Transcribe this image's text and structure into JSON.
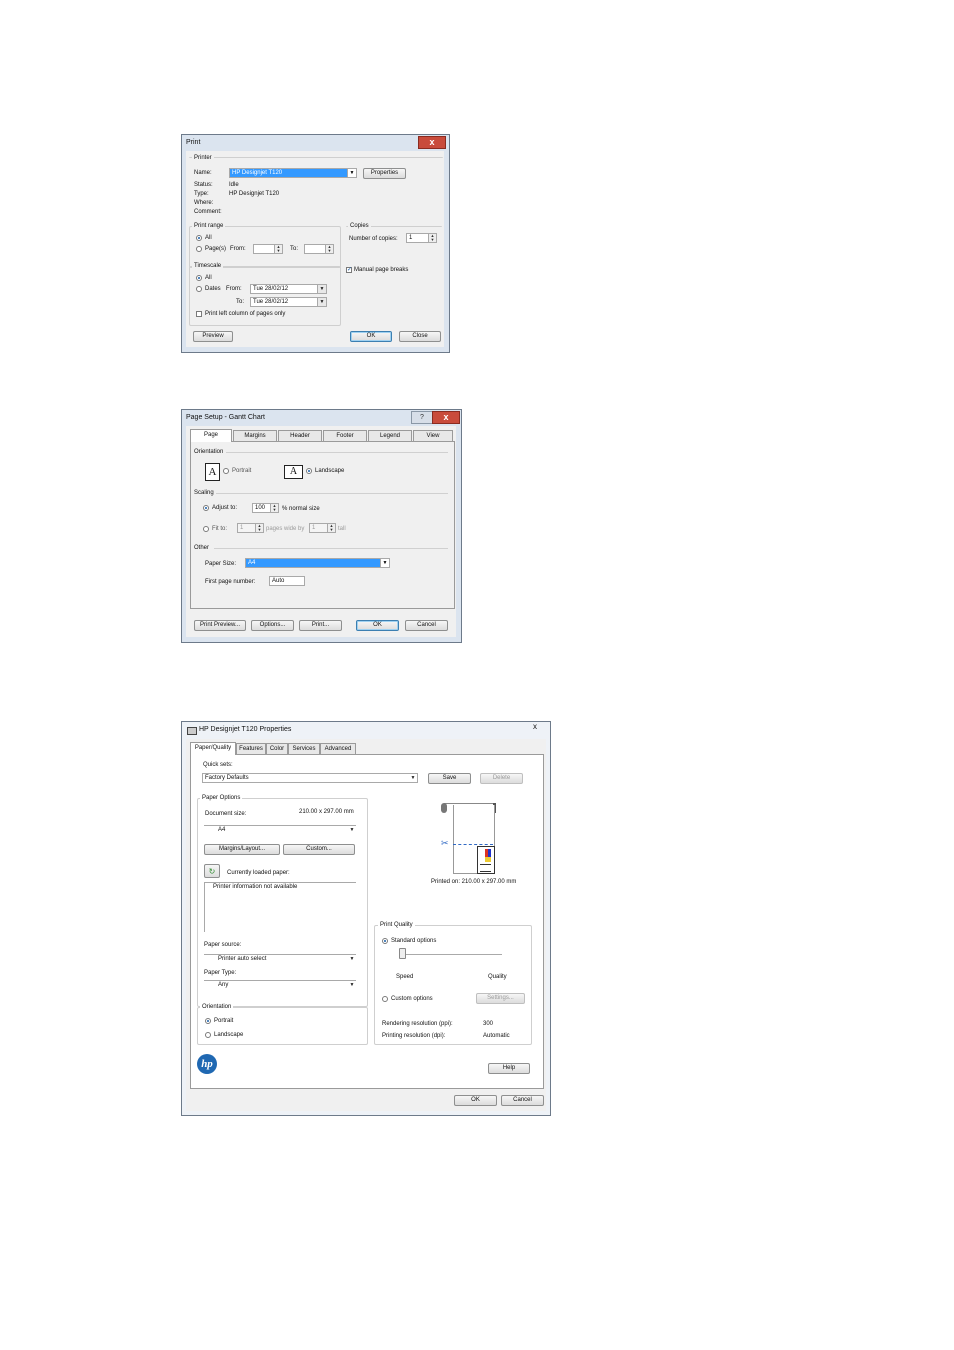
{
  "print_dialog": {
    "title": "Print",
    "close_glyph": "x",
    "printer": {
      "group": "Printer",
      "name_label": "Name:",
      "name_value": "HP Designjet T120",
      "properties_button": "Properties",
      "status_label": "Status:",
      "status_value": "Idle",
      "type_label": "Type:",
      "type_value": "HP Designjet T120",
      "where_label": "Where:",
      "comment_label": "Comment:"
    },
    "print_range": {
      "group": "Print range",
      "all_label": "All",
      "pages_label": "Page(s)",
      "from_label": "From:",
      "to_label": "To:"
    },
    "copies": {
      "group": "Copies",
      "number_label": "Number of copies:",
      "number_value": "1",
      "manual_breaks_label": "Manual page breaks"
    },
    "timescale": {
      "group": "Timescale",
      "all_label": "All",
      "dates_label": "Dates",
      "from_label": "From:",
      "from_value": "Tue 28/02/12",
      "to_label": "To:",
      "to_value": "Tue 28/02/12",
      "left_column_label": "Print left column of pages only"
    },
    "buttons": {
      "preview": "Preview",
      "ok": "OK",
      "close": "Close"
    }
  },
  "page_setup": {
    "title": "Page Setup - Gantt Chart",
    "help_glyph": "?",
    "close_glyph": "x",
    "tabs": [
      "Page",
      "Margins",
      "Header",
      "Footer",
      "Legend",
      "View"
    ],
    "orientation": {
      "group": "Orientation",
      "icon_glyph": "A",
      "portrait": "Portrait",
      "landscape": "Landscape"
    },
    "scaling": {
      "group": "Scaling",
      "adjust_label": "Adjust to:",
      "adjust_value": "100",
      "normal_size": "% normal size",
      "fit_label": "Fit to:",
      "fit_wide_value": "1",
      "pages_wide_by": "pages wide by",
      "fit_tall_value": "1",
      "tall": "tall"
    },
    "other": {
      "group": "Other",
      "paper_size_label": "Paper Size:",
      "paper_size_value": "A4",
      "first_page_label": "First page number:",
      "first_page_value": "Auto"
    },
    "buttons": {
      "print_preview": "Print Preview...",
      "options": "Options...",
      "print": "Print...",
      "ok": "OK",
      "cancel": "Cancel"
    }
  },
  "hp_properties": {
    "title": "HP Designjet T120 Properties",
    "close_glyph": "x",
    "tabs": [
      "Paper/Quality",
      "Features",
      "Color",
      "Services",
      "Advanced"
    ],
    "quick_sets_label": "Quick sets:",
    "quick_sets_value": "Factory Defaults",
    "save_button": "Save",
    "delete_button": "Delete",
    "paper_options": {
      "group": "Paper Options",
      "document_size_label": "Document size:",
      "document_size_value": "210.00 x 297.00 mm",
      "size_dropdown": "A4",
      "margins_button": "Margins/Layout...",
      "custom_button": "Custom...",
      "refresh_glyph": "↻",
      "loaded_paper_label": "Currently loaded paper:",
      "info_text": "Printer information not available",
      "paper_source_label": "Paper source:",
      "paper_source_value": "Printer auto select",
      "paper_type_label": "Paper Type:",
      "paper_type_value": "Any"
    },
    "orientation": {
      "group": "Orientation",
      "portrait": "Portrait",
      "landscape": "Landscape"
    },
    "preview_caption": "Printed on: 210.00 x 297.00 mm",
    "scissors_glyph": "✂",
    "print_quality": {
      "group": "Print Quality",
      "standard_label": "Standard options",
      "speed_label": "Speed",
      "quality_label": "Quality",
      "custom_label": "Custom options",
      "settings_button": "Settings...",
      "rendering_label": "Rendering resolution (ppi):",
      "rendering_value": "300",
      "printing_label": "Printing resolution (dpi):",
      "printing_value": "Automatic"
    },
    "logo_text": "hp",
    "help_button": "Help",
    "ok_button": "OK",
    "cancel_button": "Cancel"
  }
}
